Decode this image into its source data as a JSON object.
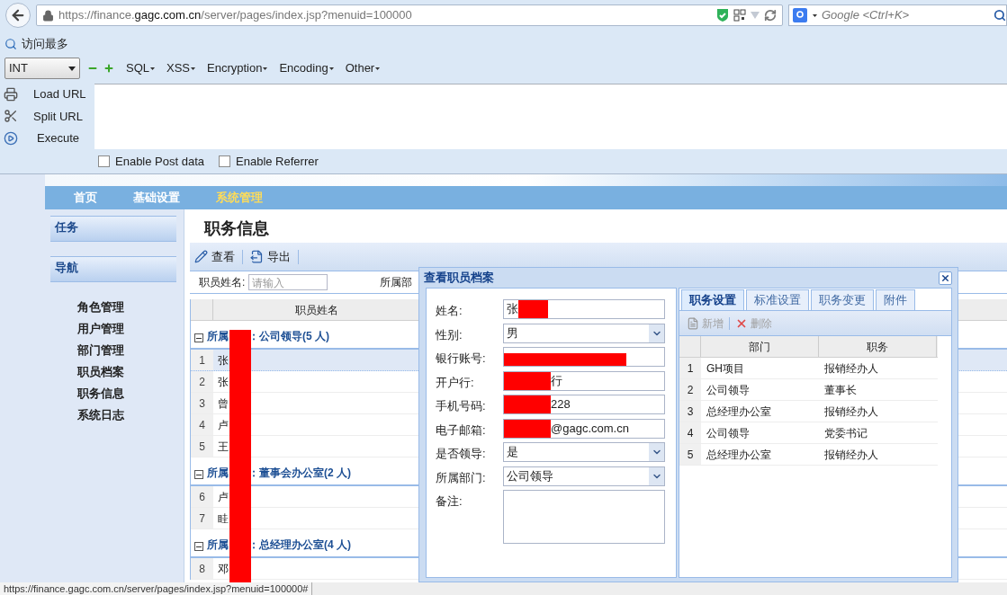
{
  "browser": {
    "url": "https://finance.**gagc.com.cn**/server/pages/index.jsp?menuid=100000",
    "search_placeholder": "Google <Ctrl+K>"
  },
  "bookmarks": [
    "访问最多"
  ],
  "hackbar": {
    "select_value": "INT",
    "menus": [
      "SQL",
      "XSS",
      "Encryption",
      "Encoding",
      "Other"
    ],
    "actions": [
      {
        "label": "Load URL",
        "kind": "load"
      },
      {
        "label": "Split URL",
        "kind": "split"
      },
      {
        "label": "Execute",
        "kind": "execute"
      }
    ],
    "options": [
      {
        "label": "Enable Post data",
        "checked": false
      },
      {
        "label": "Enable Referrer",
        "checked": false
      }
    ]
  },
  "app": {
    "nav": [
      {
        "label": "首页",
        "selected": false
      },
      {
        "label": "基础设置",
        "selected": false
      },
      {
        "label": "系统管理",
        "selected": true
      }
    ],
    "sidebar": {
      "panels": [
        "任务",
        "导航"
      ],
      "items": [
        "角色管理",
        "用户管理",
        "部门管理",
        "职员档案",
        "职务信息",
        "系统日志"
      ]
    },
    "title": "职务信息",
    "toolbar": [
      {
        "label": "查看",
        "kind": "view"
      },
      {
        "label": "导出",
        "kind": "export"
      }
    ],
    "filter": {
      "label": "职员姓名:",
      "placeholder": "请输入",
      "label_2": "所属部"
    },
    "grid": {
      "column": "职员姓名",
      "groups": [
        {
          "label_start": "所属",
          "label_end": "：公司领导(5 人)",
          "expanded": true,
          "rows": [
            {
              "num": "1",
              "name": "张",
              "selected": true
            },
            {
              "num": "2",
              "name": "张",
              "selected": false
            },
            {
              "num": "3",
              "name": "曾",
              "selected": false
            },
            {
              "num": "4",
              "name": "卢",
              "selected": false
            },
            {
              "num": "5",
              "name": "王",
              "selected": false
            }
          ]
        },
        {
          "label_start": "所属",
          "label_end": "：董事会办公室(2 人)",
          "expanded": true,
          "rows": [
            {
              "num": "6",
              "name": "卢",
              "selected": false
            },
            {
              "num": "7",
              "name": "眭",
              "selected": false
            }
          ]
        },
        {
          "label_start": "所属",
          "label_end": "：总经理办公室(4 人)",
          "expanded": true,
          "rows": [
            {
              "num": "8",
              "name": "邓",
              "selected": false
            }
          ]
        }
      ]
    }
  },
  "dialog": {
    "title": "查看职员档案",
    "fields": [
      {
        "label": "姓名:",
        "kind": "text",
        "value": "张",
        "redacted": true
      },
      {
        "label": "性别:",
        "kind": "select",
        "value": "男"
      },
      {
        "label": "银行账号:",
        "kind": "text",
        "redacted": true
      },
      {
        "label": "开户行:",
        "kind": "text",
        "value_after": "行",
        "redacted": true
      },
      {
        "label": "手机号码:",
        "kind": "text",
        "value_after": "228",
        "redacted": true
      },
      {
        "label": "电子邮箱:",
        "kind": "text",
        "value_after": "@gagc.com.cn",
        "redacted": true
      },
      {
        "label": "是否领导:",
        "kind": "select",
        "value": "是"
      },
      {
        "label": "所属部门:",
        "kind": "select",
        "value": "公司领导"
      },
      {
        "label": "备注:",
        "kind": "textarea"
      }
    ],
    "tabs": [
      {
        "label": "职务设置",
        "selected": true
      },
      {
        "label": "标准设置",
        "selected": false
      },
      {
        "label": "职务变更",
        "selected": false
      },
      {
        "label": "附件",
        "selected": false
      }
    ],
    "toolbar": [
      {
        "label": "新增",
        "kind": "add",
        "disabled": true
      },
      {
        "label": "删除",
        "kind": "delete",
        "disabled": true
      }
    ],
    "columns": [
      "部门",
      "职务"
    ],
    "rows": [
      {
        "num": "1",
        "cells": [
          "GH项目",
          "报销经办人"
        ]
      },
      {
        "num": "2",
        "cells": [
          "公司领导",
          "董事长"
        ]
      },
      {
        "num": "3",
        "cells": [
          "总经理办公室",
          "报销经办人"
        ]
      },
      {
        "num": "4",
        "cells": [
          "公司领导",
          "党委书记"
        ]
      },
      {
        "num": "5",
        "cells": [
          "总经理办公室",
          "报销经办人"
        ]
      }
    ]
  },
  "status_bar": "https://finance.gagc.com.cn/server/pages/index.jsp?menuid=100000#"
}
